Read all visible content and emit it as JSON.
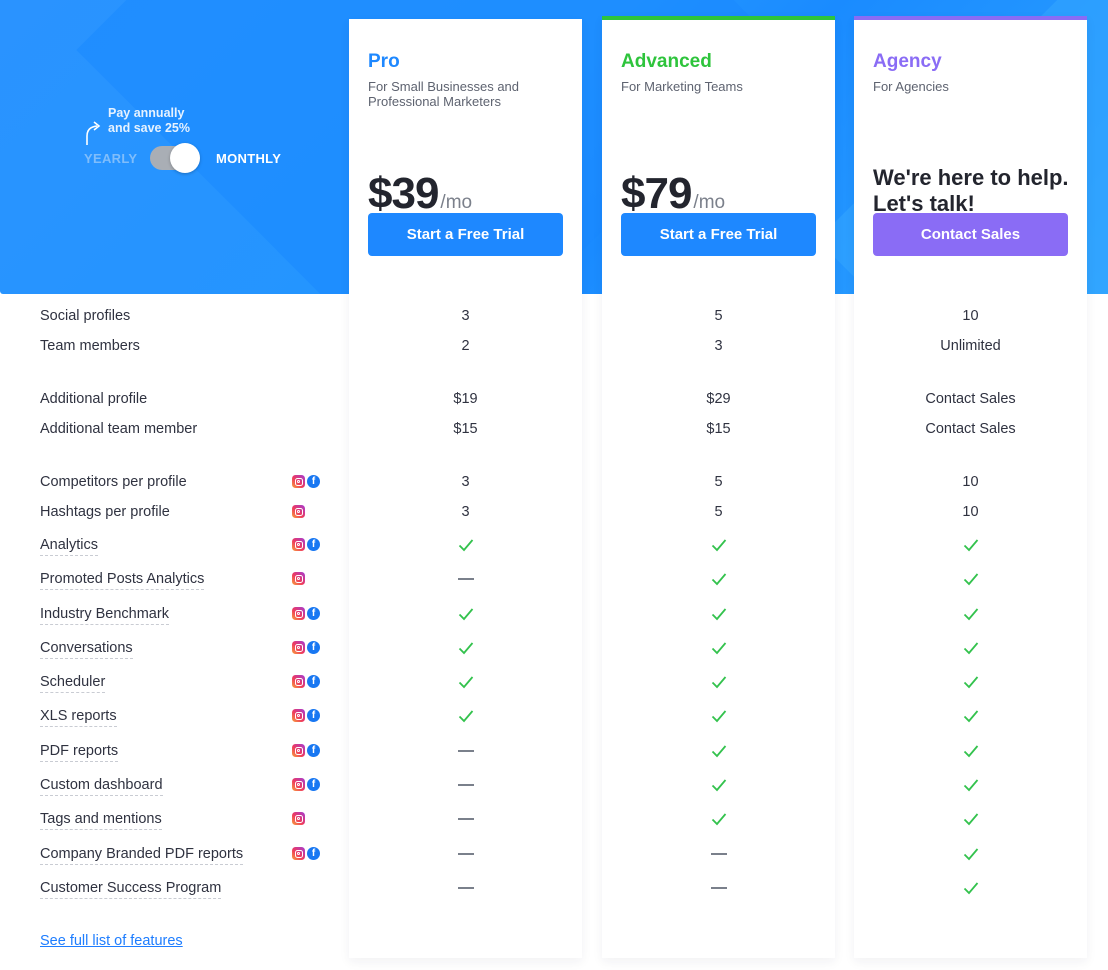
{
  "billing_toggle": {
    "save_note_line1": "Pay annually",
    "save_note_line2": "and save 25%",
    "yearly_label": "YEARLY",
    "monthly_label": "MONTHLY",
    "selected": "MONTHLY"
  },
  "colors": {
    "brand_blue": "#1e88ff",
    "advanced_green": "#2ec43c",
    "agency_purple": "#8a6cf5",
    "check_green": "#33c24d"
  },
  "plans": [
    {
      "name": "Pro",
      "subtitle": "For Small Businesses and Professional Marketers",
      "price": "$39",
      "period": "/mo",
      "cta": "Start a Free Trial",
      "name_color": "#1e88ff",
      "cta_color": "#1e88ff"
    },
    {
      "name": "Advanced",
      "subtitle": "For Marketing Teams",
      "price": "$79",
      "period": "/mo",
      "cta": "Start a Free Trial",
      "name_color": "#2ec43c",
      "cta_color": "#1e88ff"
    },
    {
      "name": "Agency",
      "subtitle": "For Agencies",
      "pitch": "We're here to help. Let's talk!",
      "cta": "Contact Sales",
      "name_color": "#8a6cf5",
      "cta_color": "#8a6cf5"
    }
  ],
  "features": [
    {
      "label": "Social profiles",
      "dotted": false,
      "icons": [],
      "values": [
        "3",
        "5",
        "10"
      ]
    },
    {
      "label": "Team members",
      "dotted": false,
      "icons": [],
      "values": [
        "2",
        "3",
        "Unlimited"
      ]
    },
    {
      "label": "Additional profile",
      "dotted": false,
      "icons": [],
      "values": [
        "$19",
        "$29",
        "Contact Sales"
      ]
    },
    {
      "label": "Additional team member",
      "dotted": false,
      "icons": [],
      "values": [
        "$15",
        "$15",
        "Contact Sales"
      ]
    },
    {
      "label": "Competitors per profile",
      "dotted": false,
      "icons": [
        "instagram",
        "facebook"
      ],
      "values": [
        "3",
        "5",
        "10"
      ]
    },
    {
      "label": "Hashtags per profile",
      "dotted": false,
      "icons": [
        "instagram"
      ],
      "values": [
        "3",
        "5",
        "10"
      ]
    },
    {
      "label": "Analytics",
      "dotted": true,
      "icons": [
        "instagram",
        "facebook"
      ],
      "values": [
        "check",
        "check",
        "check"
      ]
    },
    {
      "label": "Promoted Posts Analytics",
      "dotted": true,
      "icons": [
        "instagram"
      ],
      "values": [
        "dash",
        "check",
        "check"
      ]
    },
    {
      "label": "Industry Benchmark",
      "dotted": true,
      "icons": [
        "instagram",
        "facebook"
      ],
      "values": [
        "check",
        "check",
        "check"
      ]
    },
    {
      "label": "Conversations",
      "dotted": true,
      "icons": [
        "instagram",
        "facebook"
      ],
      "values": [
        "check",
        "check",
        "check"
      ]
    },
    {
      "label": "Scheduler",
      "dotted": true,
      "icons": [
        "instagram",
        "facebook"
      ],
      "values": [
        "check",
        "check",
        "check"
      ]
    },
    {
      "label": "XLS reports",
      "dotted": true,
      "icons": [
        "instagram",
        "facebook"
      ],
      "values": [
        "check",
        "check",
        "check"
      ]
    },
    {
      "label": "PDF reports",
      "dotted": true,
      "icons": [
        "instagram",
        "facebook"
      ],
      "values": [
        "dash",
        "check",
        "check"
      ]
    },
    {
      "label": "Custom dashboard",
      "dotted": true,
      "icons": [
        "instagram",
        "facebook"
      ],
      "values": [
        "dash",
        "check",
        "check"
      ]
    },
    {
      "label": "Tags and mentions",
      "dotted": true,
      "icons": [
        "instagram"
      ],
      "values": [
        "dash",
        "check",
        "check"
      ]
    },
    {
      "label": "Company Branded PDF reports",
      "dotted": true,
      "icons": [
        "instagram",
        "facebook"
      ],
      "values": [
        "dash",
        "dash",
        "check"
      ]
    },
    {
      "label": "Customer Success Program",
      "dotted": true,
      "icons": [],
      "values": [
        "dash",
        "dash",
        "check"
      ]
    }
  ],
  "full_list_link": "See full list of features"
}
